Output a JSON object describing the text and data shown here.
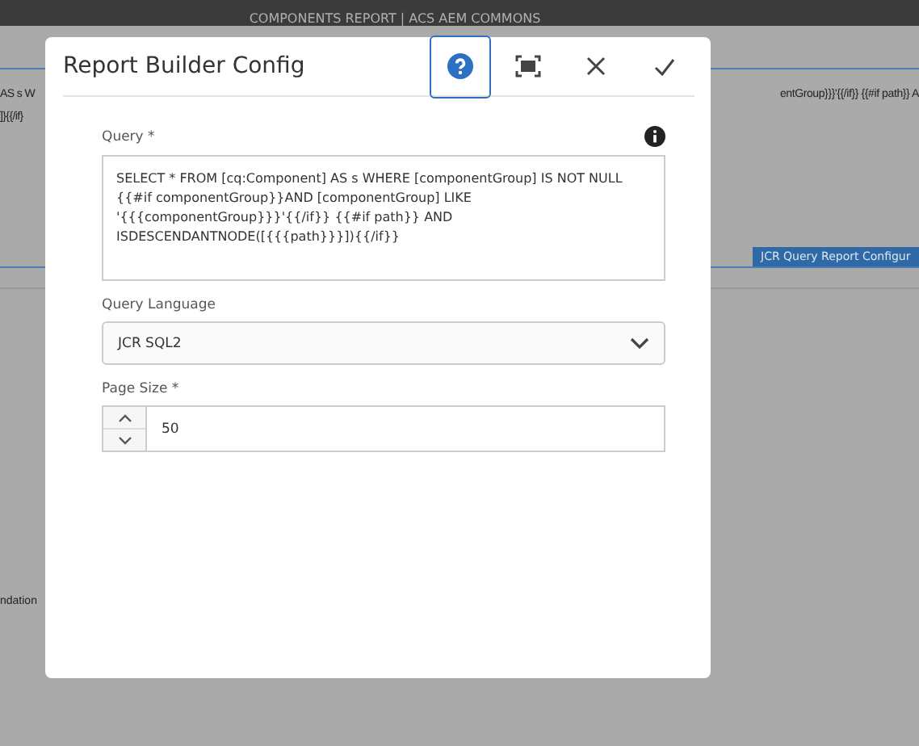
{
  "page": {
    "title": "COMPONENTS REPORT | ACS AEM COMMONS",
    "left_fragments": [
      "AS s W",
      "]}{{/if}"
    ],
    "right_fragment": "entGroup}}}'{{/if}} {{#if path}} A",
    "panel_tab": "JCR Query Report Configur",
    "bottom_fragment": "ndation"
  },
  "dialog": {
    "title": "Report Builder Config",
    "actions": [
      {
        "kind": "help",
        "focused": true
      },
      {
        "kind": "fullscreen",
        "focused": false
      },
      {
        "kind": "close",
        "focused": false
      },
      {
        "kind": "done",
        "focused": false
      }
    ],
    "fields": [
      {
        "kind": "textarea",
        "label": "Query *",
        "info": true,
        "value": "SELECT * FROM [cq:Component] AS s WHERE [componentGroup] IS NOT NULL {{#if componentGroup}}AND [componentGroup] LIKE '{{{componentGroup}}}'{{/if}} {{#if path}} AND ISDESCENDANTNODE([{{{path}}}]){{/if}}"
      },
      {
        "kind": "select",
        "label": "Query Language",
        "value": "JCR SQL2"
      },
      {
        "kind": "number",
        "label": "Page Size *",
        "value": "50"
      }
    ]
  }
}
